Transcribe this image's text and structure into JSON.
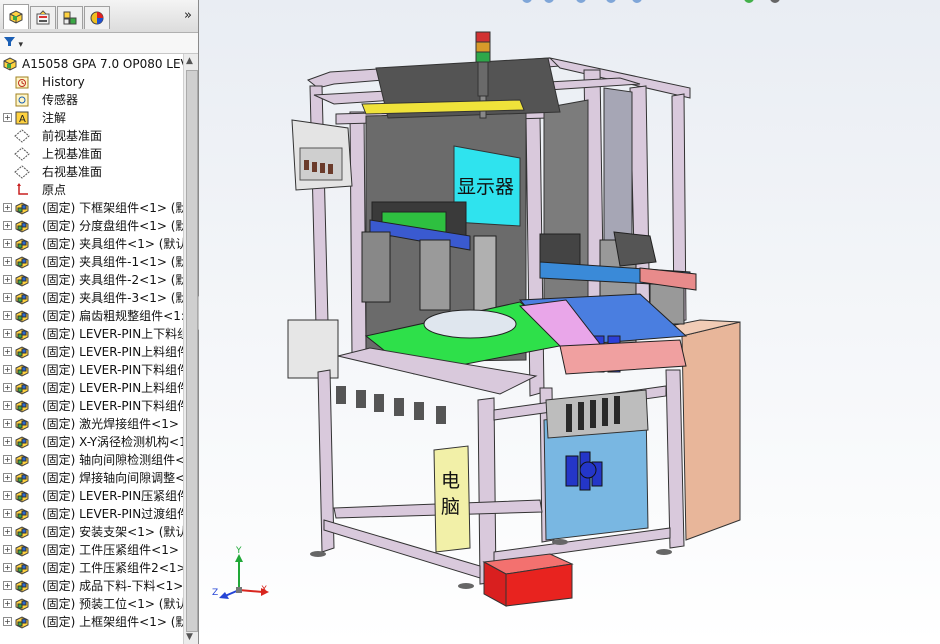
{
  "toolbar": {
    "expand_glyph": "»",
    "filter_glyph": "▾"
  },
  "tree": {
    "root": "A15058 GPA 7.0 OP080 LEV",
    "items": [
      {
        "text": "History",
        "icon": "history-icon",
        "expand": false
      },
      {
        "text": "传感器",
        "icon": "sensor-icon",
        "expand": false
      },
      {
        "text": "注解",
        "icon": "annotation-icon",
        "expand": true
      },
      {
        "text": "前视基准面",
        "icon": "plane-icon",
        "expand": false
      },
      {
        "text": "上视基准面",
        "icon": "plane-icon",
        "expand": false
      },
      {
        "text": "右视基准面",
        "icon": "plane-icon",
        "expand": false
      },
      {
        "text": "原点",
        "icon": "origin-icon",
        "expand": false
      },
      {
        "text": "(固定) 下框架组件<1> (默",
        "icon": "assembly-icon",
        "expand": true
      },
      {
        "text": "(固定) 分度盘组件<1> (默",
        "icon": "assembly-icon",
        "expand": true
      },
      {
        "text": "(固定) 夹具组件<1> (默认",
        "icon": "assembly-icon",
        "expand": true
      },
      {
        "text": "(固定) 夹具组件-1<1> (默",
        "icon": "assembly-icon",
        "expand": true
      },
      {
        "text": "(固定) 夹具组件-2<1> (默",
        "icon": "assembly-icon",
        "expand": true
      },
      {
        "text": "(固定) 夹具组件-3<1> (默",
        "icon": "assembly-icon",
        "expand": true
      },
      {
        "text": "(固定) 扁齿粗规整组件<1:",
        "icon": "assembly-icon",
        "expand": true
      },
      {
        "text": "(固定) LEVER-PIN上下料组",
        "icon": "assembly-icon",
        "expand": true
      },
      {
        "text": "(固定) LEVER-PIN上料组件",
        "icon": "assembly-icon",
        "expand": true
      },
      {
        "text": "(固定) LEVER-PIN下料组件",
        "icon": "assembly-icon",
        "expand": true
      },
      {
        "text": "(固定) LEVER-PIN上料组件",
        "icon": "assembly-icon",
        "expand": true
      },
      {
        "text": "(固定) LEVER-PIN下料组件",
        "icon": "assembly-icon",
        "expand": true
      },
      {
        "text": "(固定) 激光焊接组件<1> (",
        "icon": "assembly-icon",
        "expand": true
      },
      {
        "text": "(固定) X-Y涡径检测机构<1",
        "icon": "assembly-icon",
        "expand": true
      },
      {
        "text": "(固定) 轴向间隙检测组件<",
        "icon": "assembly-icon",
        "expand": true
      },
      {
        "text": "(固定) 焊接轴向间隙调整<",
        "icon": "assembly-icon",
        "expand": true
      },
      {
        "text": "(固定) LEVER-PIN压紧组件",
        "icon": "assembly-icon",
        "expand": true
      },
      {
        "text": "(固定) LEVER-PIN过渡组件",
        "icon": "assembly-icon",
        "expand": true
      },
      {
        "text": "(固定) 安装支架<1> (默认",
        "icon": "assembly-icon",
        "expand": true
      },
      {
        "text": "(固定) 工件压紧组件<1> (",
        "icon": "assembly-icon",
        "expand": true
      },
      {
        "text": "(固定) 工件压紧组件2<1>",
        "icon": "assembly-icon",
        "expand": true
      },
      {
        "text": "(固定) 成品下料-下料<1>",
        "icon": "assembly-icon",
        "expand": true
      },
      {
        "text": "(固定) 预装工位<1> (默认",
        "icon": "assembly-icon",
        "expand": true
      },
      {
        "text": "(固定) 上框架组件<1> (默",
        "icon": "assembly-icon",
        "expand": true
      }
    ]
  },
  "viewport": {
    "label_screen": "显示器",
    "label_pc_1": "电",
    "label_pc_2": "脑",
    "triad_x": "X",
    "triad_y": "Y",
    "triad_z": "Z"
  },
  "colors": {
    "frame": "#d9c9dc",
    "screen_panel": "#2fe3ee",
    "pc_box": "#f2f0a8",
    "red_box": "#e8231f",
    "cabinet": "#e8b69a",
    "green_plate": "#2ee04a",
    "blue_panel": "#79b7e2"
  }
}
